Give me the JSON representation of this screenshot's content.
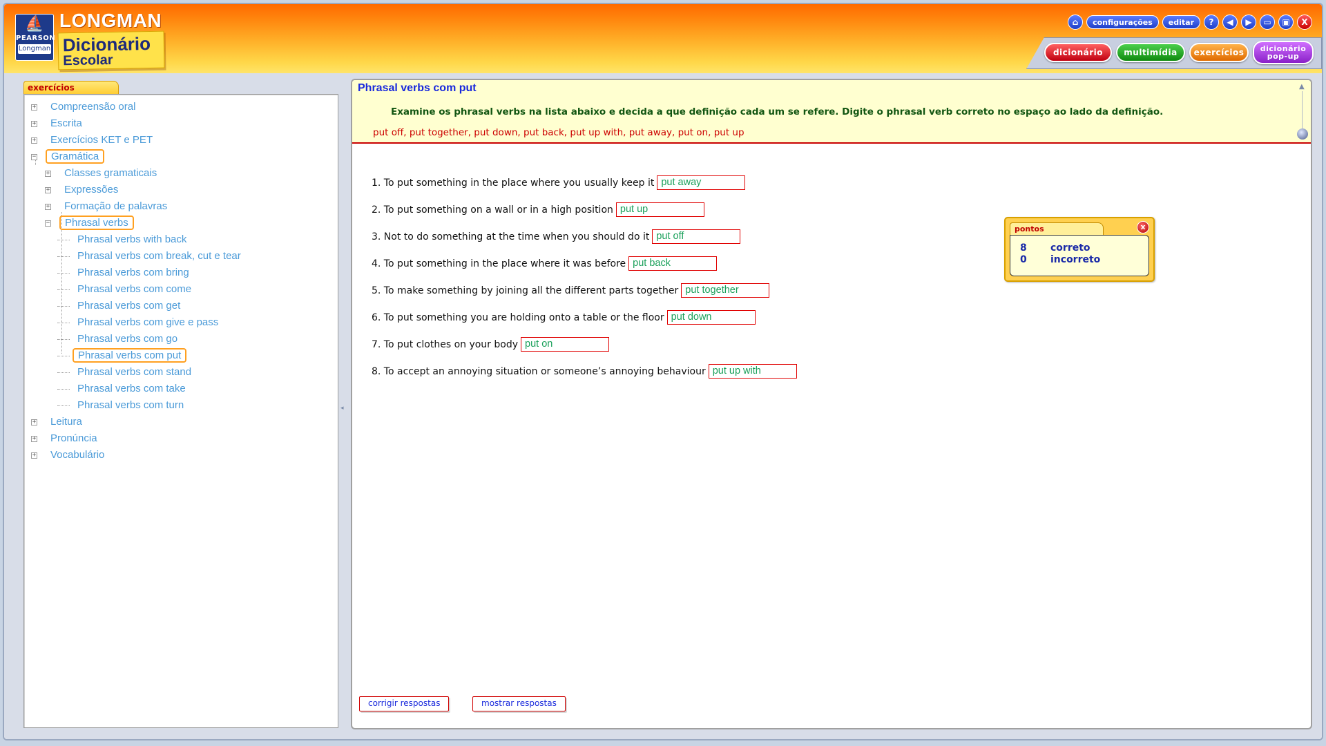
{
  "brand": {
    "publisher": "PEARSON",
    "publisher_sub": "Longman",
    "name": "LONGMAN",
    "title_line1": "Dicionário",
    "title_line2": "Escolar"
  },
  "top_controls": {
    "configuracoes": "configurações",
    "editar": "editar",
    "help": "?",
    "close": "X"
  },
  "nav_tabs": {
    "dicionario": "dicionário",
    "multimidia": "multimídia",
    "exercicios": "exercícios",
    "popup_line1": "dicionário",
    "popup_line2": "pop-up"
  },
  "left_panel": {
    "tab_label": "exercícios",
    "tree": [
      {
        "label": "Compreensão oral",
        "expander": "+"
      },
      {
        "label": "Escrita",
        "expander": "+"
      },
      {
        "label": "Exercícios KET e PET",
        "expander": "+"
      },
      {
        "label": "Gramática",
        "expander": "−"
      },
      {
        "label": "Classes gramaticais",
        "expander": "+"
      },
      {
        "label": "Expressões",
        "expander": "+"
      },
      {
        "label": "Formação de palavras",
        "expander": "+"
      },
      {
        "label": "Phrasal verbs",
        "expander": "−"
      },
      {
        "label": "Phrasal verbs with back"
      },
      {
        "label": "Phrasal verbs com break, cut e tear"
      },
      {
        "label": "Phrasal verbs com bring"
      },
      {
        "label": "Phrasal verbs com come"
      },
      {
        "label": "Phrasal verbs com get"
      },
      {
        "label": "Phrasal verbs com give e pass"
      },
      {
        "label": "Phrasal verbs com go"
      },
      {
        "label": "Phrasal verbs com put"
      },
      {
        "label": "Phrasal verbs com stand"
      },
      {
        "label": "Phrasal verbs com take"
      },
      {
        "label": "Phrasal verbs com turn"
      },
      {
        "label": "Leitura",
        "expander": "+"
      },
      {
        "label": "Pronúncia",
        "expander": "+"
      },
      {
        "label": "Vocabulário",
        "expander": "+"
      }
    ]
  },
  "exercise": {
    "title": "Phrasal verbs com put",
    "instruction": "Examine os phrasal verbs na lista abaixo e decida a que definição cada um se refere. Digite o phrasal verb correto no espaço ao lado da definição.",
    "word_list": "put off, put together, put down, put back, put up with, put away, put on, put up",
    "questions": [
      {
        "text": "1. To put something in the place where you usually keep it",
        "answer": "put away"
      },
      {
        "text": "2. To put something on a wall or in a high position",
        "answer": "put up"
      },
      {
        "text": "3. Not to do something at the time when you should do it",
        "answer": "put off"
      },
      {
        "text": "4. To put something in the place where it was before",
        "answer": "put back"
      },
      {
        "text": "5. To make something by joining all the different parts together",
        "answer": "put together"
      },
      {
        "text": "6. To put something you are holding onto a table or the floor",
        "answer": "put down"
      },
      {
        "text": "7. To put clothes on your body",
        "answer": "put on"
      },
      {
        "text": "8. To accept an annoying situation or someone’s annoying behaviour",
        "answer": "put up with"
      }
    ],
    "buttons": {
      "check": "corrigir respostas",
      "show": "mostrar respostas"
    }
  },
  "score": {
    "tab_label": "pontos",
    "close": "x",
    "correct_count": "8",
    "correct_label": "correto",
    "incorrect_count": "0",
    "incorrect_label": "incorreto"
  },
  "colors": {
    "accent_blue": "#1a2adc",
    "answer_green": "#1aa05a",
    "error_red": "#cc0000",
    "header_orange": "#ff8a10",
    "selection_orange": "#ffa020"
  }
}
